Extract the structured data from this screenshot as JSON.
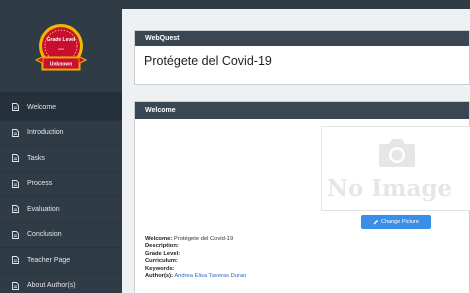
{
  "badge": {
    "title": "Grade Level",
    "value": "---",
    "ribbon": "Unknown"
  },
  "nav": {
    "items": [
      {
        "label": "Welcome",
        "icon": "document-icon",
        "active": true
      },
      {
        "label": "Introduction",
        "icon": "document-icon",
        "active": false
      },
      {
        "label": "Tasks",
        "icon": "document-icon",
        "active": false
      },
      {
        "label": "Process",
        "icon": "document-icon",
        "active": false
      },
      {
        "label": "Evaluation",
        "icon": "document-icon",
        "active": false
      },
      {
        "label": "Conclusion",
        "icon": "document-icon",
        "active": false
      },
      {
        "label": "Teacher Page",
        "icon": "document-icon",
        "active": false
      },
      {
        "label": "About Author(s)",
        "icon": "document-icon",
        "active": false
      }
    ]
  },
  "webquest": {
    "header": "WebQuest",
    "title": "Protégete del Covid-19"
  },
  "welcome": {
    "header": "Welcome",
    "no_image_text": "No Image",
    "change_picture_label": "Change Picture",
    "fields": {
      "welcome_label": "Welcome:",
      "welcome_value": "Protégete del Covid-19",
      "description_label": "Description:",
      "grade_label": "Grade Level:",
      "curriculum_label": "Curriculum:",
      "keywords_label": "Keywords:",
      "authors_label": "Author(s):",
      "authors_value": "Andrea Elisa Taveras Duran"
    }
  },
  "colors": {
    "sidebar": "#2f3b45",
    "panel_header": "#3a4752",
    "button": "#3a8ee6",
    "link": "#3066c8",
    "badge_red": "#c8102e",
    "badge_gold": "#f0b800"
  }
}
